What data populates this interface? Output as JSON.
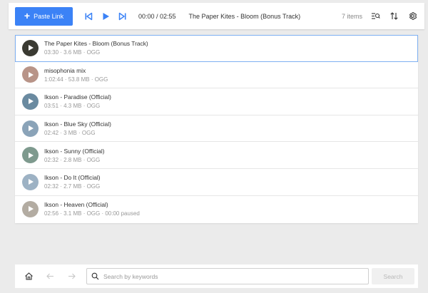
{
  "toolbar": {
    "paste_label": "Paste Link",
    "time": "00:00 / 02:55",
    "now_playing": "The Paper Kites - Bloom (Bonus Track)",
    "items_count": "7 items"
  },
  "colors": {
    "accent": "#3b82f6",
    "active_outline": "#7fb0f2"
  },
  "icons": [
    "skip-previous-icon",
    "play-icon",
    "skip-next-icon",
    "search-list-icon",
    "sort-icon",
    "gear-icon",
    "home-icon",
    "back-arrow-icon",
    "forward-arrow-icon",
    "search-icon"
  ],
  "tracks": [
    {
      "title": "The Paper Kites - Bloom (Bonus Track)",
      "meta": "03:30 · 3.6 MB · OGG",
      "thumb_color": "#3a3a32"
    },
    {
      "title": "misophonia mix",
      "meta": "1:02:44 · 53.8 MB · OGG",
      "thumb_color": "#b89488"
    },
    {
      "title": "Ikson - Paradise (Official)",
      "meta": "03:51 · 4.3 MB · OGG",
      "thumb_color": "#6a8aa0"
    },
    {
      "title": "Ikson - Blue Sky (Official)",
      "meta": "02:42 · 3 MB · OGG",
      "thumb_color": "#8aa3b8"
    },
    {
      "title": "Ikson - Sunny (Official)",
      "meta": "02:32 · 2.8 MB · OGG",
      "thumb_color": "#7e9a8e"
    },
    {
      "title": "Ikson - Do It (Official)",
      "meta": "02:32 · 2.7 MB · OGG",
      "thumb_color": "#9db2c4"
    },
    {
      "title": "Ikson - Heaven (Official)",
      "meta": "02:56 · 3.1 MB · OGG · 00:00 paused",
      "thumb_color": "#b3aca2"
    }
  ],
  "search": {
    "placeholder": "Search by keywords",
    "button_label": "Search"
  }
}
